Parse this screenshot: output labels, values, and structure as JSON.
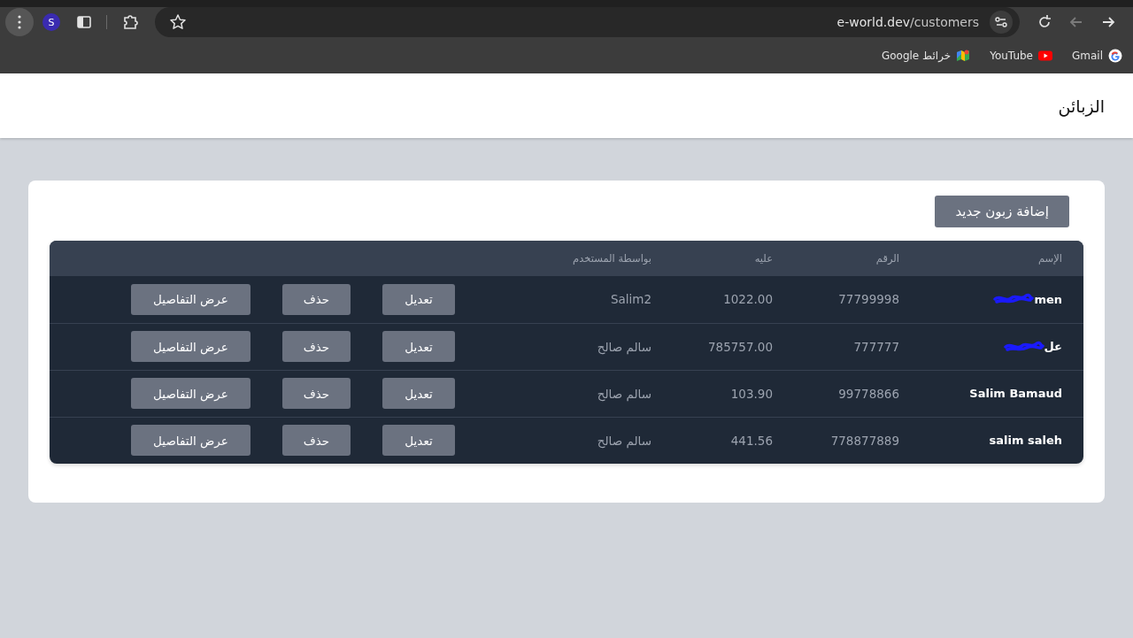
{
  "browser": {
    "profile_initial": "S",
    "url_host": "e-world.dev",
    "url_path": "/customers",
    "nav": [
      {
        "kind": "back",
        "disabled": false
      },
      {
        "kind": "forward",
        "disabled": true
      }
    ],
    "bookmarks": [
      {
        "kind": "gmail",
        "label": "Gmail"
      },
      {
        "kind": "youtube",
        "label": "YouTube"
      },
      {
        "kind": "maps",
        "label": "خرائط Google"
      }
    ]
  },
  "header": {
    "title": "الزبائن"
  },
  "add_button": "إضافة زبون جديد",
  "table": {
    "columns": [
      "الإسم",
      "الرقم",
      "عليه",
      "بواسطة المستخدم"
    ],
    "rows": [
      {
        "name": "men",
        "redacted": true,
        "number": "77799998",
        "balance": "1022.00",
        "user": "Salim2",
        "actions": [
          "تعديل",
          "حذف",
          "عرض التفاصيل"
        ]
      },
      {
        "name": "عل",
        "redacted": true,
        "number": "777777",
        "balance": "785757.00",
        "user": "سالم صالح",
        "actions": [
          "تعديل",
          "حذف",
          "عرض التفاصيل"
        ]
      },
      {
        "name": "Salim Bamaud",
        "redacted": false,
        "number": "99778866",
        "balance": "103.90",
        "user": "سالم صالح",
        "actions": [
          "تعديل",
          "حذف",
          "عرض التفاصيل"
        ]
      },
      {
        "name": "salim saleh",
        "redacted": false,
        "number": "778877889",
        "balance": "441.56",
        "user": "سالم صالح",
        "actions": [
          "تعديل",
          "حذف",
          "عرض التفاصيل"
        ]
      }
    ]
  }
}
